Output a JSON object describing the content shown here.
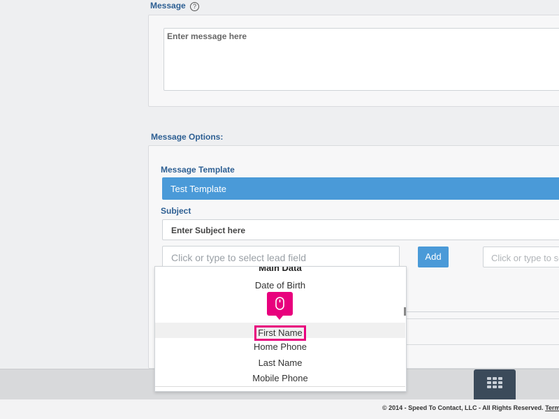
{
  "message_section": {
    "label": "Message",
    "help_icon": "question-circle-icon",
    "textarea_placeholder": "Enter message here"
  },
  "options_section": {
    "label": "Message Options:",
    "template_label": "Message Template",
    "template_value": "Test Template",
    "subject_label": "Subject",
    "subject_placeholder": "Enter Subject here",
    "lead_field_placeholder": "Click or type to select lead field",
    "add_button": "Add",
    "lead_field_placeholder_2": "Click or type to se"
  },
  "dropdown": {
    "group_header": "Main Data",
    "items": [
      "Date of Birth",
      "First Name",
      "Home Phone",
      "Last Name",
      "Mobile Phone"
    ],
    "highlighted": "First Name",
    "cursor_icon": "mouse-click-icon"
  },
  "footer": {
    "copyright": "© 2014 - Speed To Contact, LLC - All Rights Reserved.",
    "terms_link": "Term",
    "grid_icon": "keypad-grid-icon"
  },
  "colors": {
    "accent": "#4a9ad8",
    "label_blue": "#2d5f93",
    "highlight_pink": "#e8007d"
  }
}
